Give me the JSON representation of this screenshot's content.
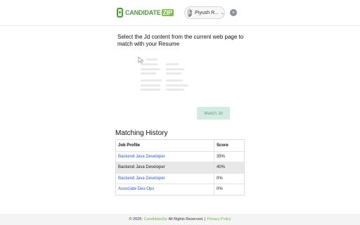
{
  "header": {
    "logo_text": "CANDIDATE",
    "logo_zip": "ZIP",
    "user_name": "Piyush R...",
    "close_icon": "close-icon"
  },
  "main": {
    "instruction": "Select the Jd content from the current web page to match with your Resume",
    "match_button": "Match Jd"
  },
  "history": {
    "title": "Matching History",
    "columns": [
      "Job Profile",
      "Score"
    ],
    "rows": [
      {
        "profile": "Backend Java Developer",
        "score": "35%"
      },
      {
        "profile": "Backend Java Developer",
        "score": "40%"
      },
      {
        "profile": "Backend Java Developer",
        "score": "0%"
      },
      {
        "profile": "Associate Dev-Ops",
        "score": "0%"
      }
    ]
  },
  "footer": {
    "prefix": "© 2025:",
    "brand": "CandidateZip",
    "suffix": "All Rights Reserved. |",
    "privacy": "Privacy Policy"
  },
  "colors": {
    "brand_green": "#4a9a3c",
    "link_blue": "#2a5bd7",
    "match_button_bg": "#d3ebe1"
  }
}
